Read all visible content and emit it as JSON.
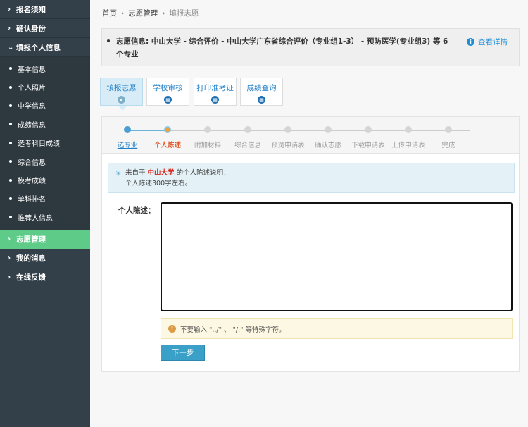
{
  "sidebar": {
    "top_items": [
      {
        "label": "报名须知"
      },
      {
        "label": "确认身份"
      },
      {
        "label": "填报个人信息"
      }
    ],
    "sub_items": [
      {
        "label": "基本信息"
      },
      {
        "label": "个人照片"
      },
      {
        "label": "中学信息"
      },
      {
        "label": "成绩信息"
      },
      {
        "label": "选考科目成绩"
      },
      {
        "label": "综合信息"
      },
      {
        "label": "模考成绩"
      },
      {
        "label": "单科排名"
      },
      {
        "label": "推荐人信息"
      }
    ],
    "bottom_items": [
      {
        "label": "志愿管理",
        "active": true
      },
      {
        "label": "我的消息"
      },
      {
        "label": "在线反馈"
      }
    ],
    "colors": {
      "bg": "#344049",
      "active": "#5fcb88"
    }
  },
  "breadcrumb": {
    "home": "首页",
    "section": "志愿管理",
    "current": "填报志愿"
  },
  "info": {
    "text": "志愿信息:  中山大学 - 综合评价 - 中山大学广东省综合评价（专业组1-3） - 预防医学(专业组3) 等 6 个专业",
    "detail_link": "查看详情"
  },
  "tabs": [
    {
      "label": "填报志愿",
      "active": true
    },
    {
      "label": "学校审核"
    },
    {
      "label": "打印准考证"
    },
    {
      "label": "成绩查询"
    }
  ],
  "steps": [
    {
      "label": "选专业",
      "state": "done"
    },
    {
      "label": "个人陈述",
      "state": "current"
    },
    {
      "label": "附加材料",
      "state": "todo"
    },
    {
      "label": "综合信息",
      "state": "todo"
    },
    {
      "label": "预览申请表",
      "state": "todo"
    },
    {
      "label": "确认志愿",
      "state": "todo"
    },
    {
      "label": "下载申请表",
      "state": "todo"
    },
    {
      "label": "上传申请表",
      "state": "todo"
    },
    {
      "label": "完成",
      "state": "todo"
    }
  ],
  "notice": {
    "prefix": "来自于",
    "school": "中山大学",
    "suffix": "的个人陈述说明：",
    "line2": "个人陈述300字左右。"
  },
  "form": {
    "label": "个人陈述：",
    "value": "",
    "warning": "不要输入 \"../\" 、 \"/.\" 等特殊字符。",
    "next_button": "下一步"
  }
}
